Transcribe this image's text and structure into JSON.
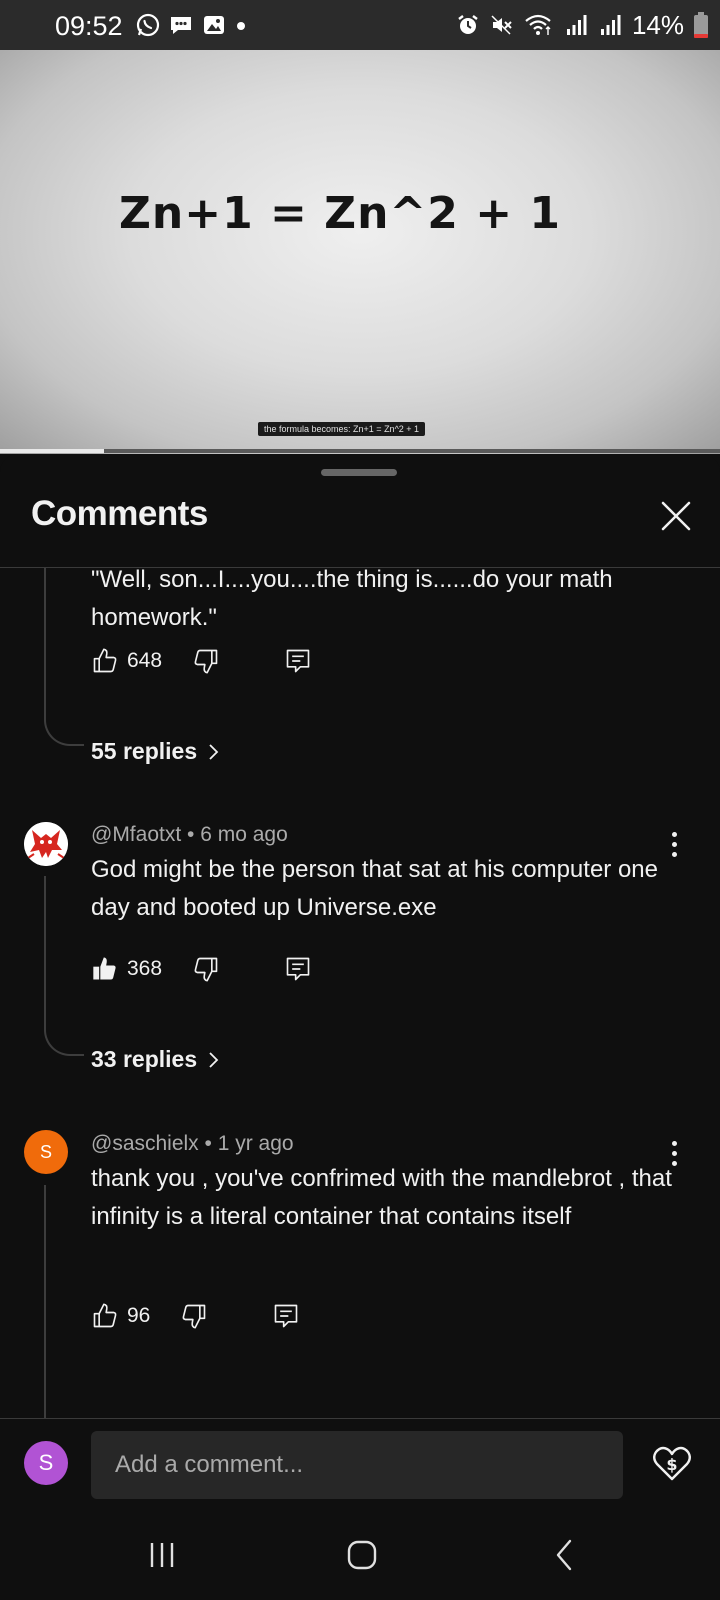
{
  "status_bar": {
    "time": "09:52",
    "battery_percent": "14%",
    "battery_level": 0.14,
    "notification_icons": [
      "whatsapp-icon",
      "chat-bubble-icon",
      "gallery-icon",
      "dot-icon"
    ],
    "system_icons": [
      "alarm-icon",
      "mute-icon",
      "wifi-icon",
      "signal-icon",
      "signal-icon",
      "battery-icon"
    ]
  },
  "video": {
    "formula": "Zn+1 = Zn^2 + 1",
    "caption": "the formula becomes: Zn+1 = Zn^2 + 1",
    "progress": 0.145
  },
  "sheet": {
    "title": "Comments",
    "close_icon": "close-icon"
  },
  "comments": [
    {
      "text_partial": "\"Well, son...I....you....the thing is......do your math homework.\"",
      "likes": "648",
      "liked": false,
      "replies_label": "55 replies"
    },
    {
      "handle": "@Mfaotxt",
      "time": "6 mo ago",
      "meta": "@Mfaotxt • 6 mo ago",
      "text": "God might be the person that sat at his computer one day and booted up Universe.exe",
      "likes": "368",
      "liked": true,
      "replies_label": "33 replies",
      "avatar": "fox-avatar"
    },
    {
      "handle": "@saschielx",
      "time": "1 yr ago",
      "meta": "@saschielx • 1 yr ago",
      "text": "thank you , you've confrimed with the mandlebrot , that infinity is a literal container that contains itself",
      "likes": "96",
      "liked": false,
      "avatar_letter": "S",
      "avatar_color": "#f06b0b"
    }
  ],
  "composer": {
    "avatar_letter": "S",
    "avatar_color": "#b153d4",
    "placeholder": "Add a comment..."
  },
  "colors": {
    "background": "#0f0f0f",
    "text": "#f1f1f1",
    "secondary_text": "#aaaaaa",
    "input_bg": "#272727"
  }
}
